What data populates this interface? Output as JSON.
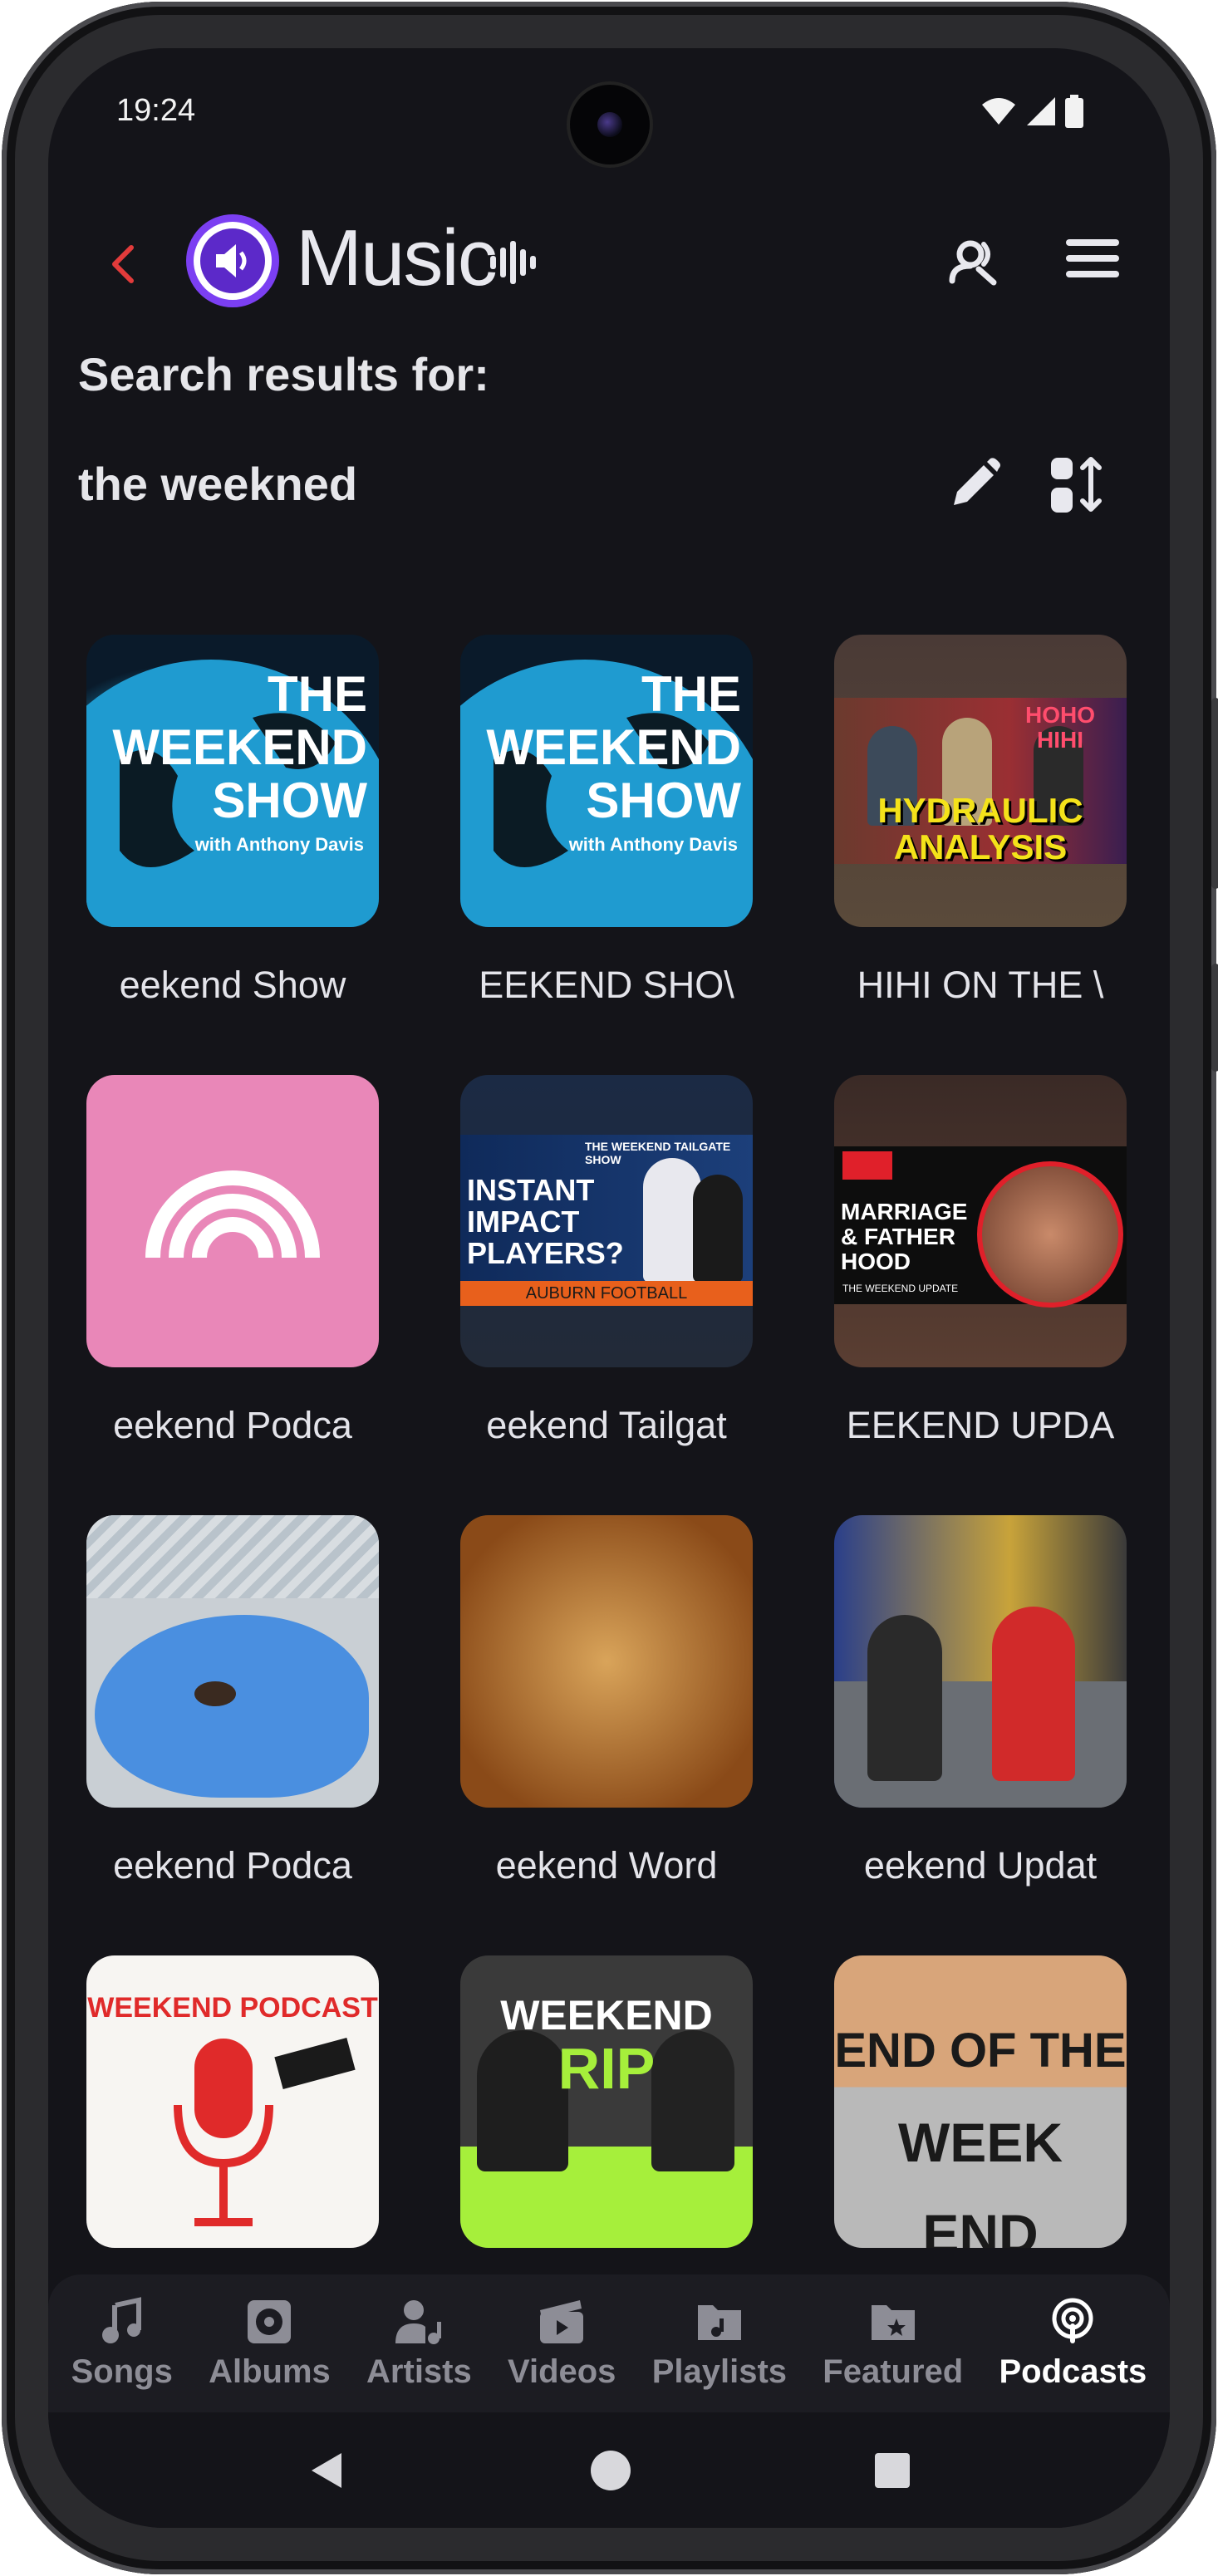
{
  "status": {
    "time": "19:24"
  },
  "header": {
    "app_name": "Music"
  },
  "search": {
    "label": "Search results for:",
    "query": "the weekned"
  },
  "results": [
    {
      "title": "The Weekend Show",
      "visible": "eekend Show"
    },
    {
      "title": "THE WEEKEND SHOW",
      "visible": "EEKEND SHO\\"
    },
    {
      "title": "HOHO HIHI ON THE WEEKEND",
      "visible": "HIHI ON THE \\"
    },
    {
      "title": "Weekend Podcast",
      "visible": "eekend Podca"
    },
    {
      "title": "The Weekend Tailgate Show",
      "visible": "eekend Tailgat"
    },
    {
      "title": "THE WEEKEND UPDATE",
      "visible": "EEKEND UPDA"
    },
    {
      "title": "Weekend Podcast",
      "visible": "eekend Podca"
    },
    {
      "title": "Weekend Word",
      "visible": "eekend Word"
    },
    {
      "title": "Weekend Update",
      "visible": "eekend Updat"
    },
    {
      "title": "Weekend Podcast",
      "visible": ""
    },
    {
      "title": "Weekend Rip",
      "visible": ""
    },
    {
      "title": "End of the Weekend",
      "visible": ""
    }
  ],
  "thumb_text": {
    "weekend_show": [
      "THE",
      "WEEKEND",
      "SHOW"
    ],
    "weekend_show_sub": "with Anthony Davis",
    "hydraulic": [
      "HYDRAULIC",
      "ANALYSIS"
    ],
    "hoho": "HOHO HIHI",
    "tailgate_top": "THE WEEKEND TAILGATE SHOW",
    "tailgate": [
      "INSTANT",
      "IMPACT",
      "PLAYERS?"
    ],
    "tailgate_bottom": "AUBURN FOOTBALL",
    "marriage": [
      "MARRIAGE",
      "& FATHER",
      "HOOD"
    ],
    "marriage_sub": "THE WEEKEND UPDATE",
    "weekend_podcast": "WEEKEND PODCAST",
    "weekend_rip": [
      "WEEKEND",
      "RIP"
    ],
    "end_week": [
      "END OF THE",
      "WEEK END"
    ]
  },
  "nav": {
    "items": [
      {
        "label": "Songs",
        "icon": "music-note-icon"
      },
      {
        "label": "Albums",
        "icon": "album-icon"
      },
      {
        "label": "Artists",
        "icon": "artist-icon"
      },
      {
        "label": "Videos",
        "icon": "video-icon"
      },
      {
        "label": "Playlists",
        "icon": "playlist-icon"
      },
      {
        "label": "Featured",
        "icon": "featured-icon"
      },
      {
        "label": "Podcasts",
        "icon": "podcast-icon"
      }
    ],
    "active": "Podcasts"
  },
  "colors": {
    "background": "#141419",
    "accent": "#7b3ff2",
    "back_arrow": "#e23b3b",
    "podcast_pink": "#e987b8",
    "rip_green": "#a6ef3b"
  }
}
